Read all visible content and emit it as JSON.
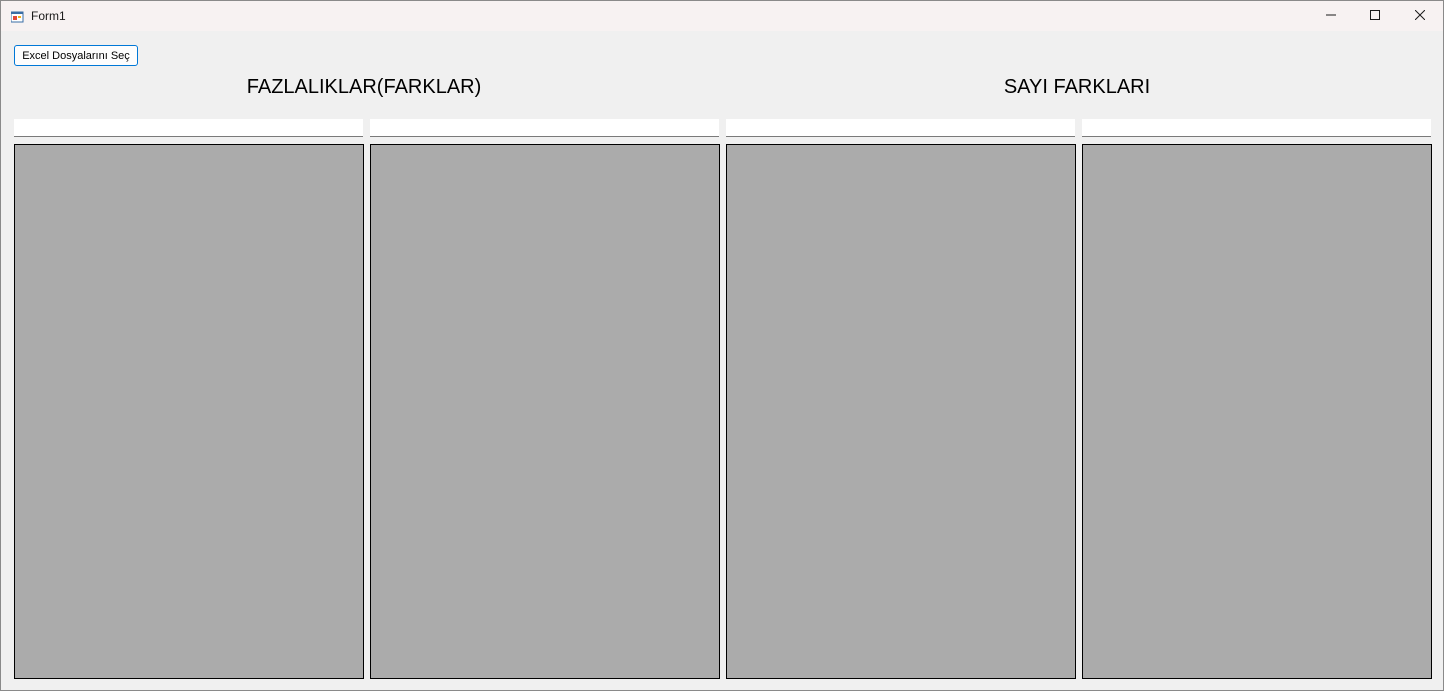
{
  "window": {
    "title": "Form1"
  },
  "toolbar": {
    "select_button_label": "Excel Dosyalarını Seç"
  },
  "sections": {
    "left_title": "FAZLALIKLAR(FARKLAR)",
    "right_title": "SAYI FARKLARI"
  },
  "inputs": [
    {
      "value": ""
    },
    {
      "value": ""
    },
    {
      "value": ""
    },
    {
      "value": ""
    }
  ],
  "icons": {
    "app": "form-app-icon",
    "minimize": "minimize-icon",
    "maximize": "maximize-icon",
    "close": "close-icon"
  },
  "colors": {
    "grid_background": "#ababab",
    "form_background": "#f0f0f0",
    "button_border": "#0078d7"
  }
}
